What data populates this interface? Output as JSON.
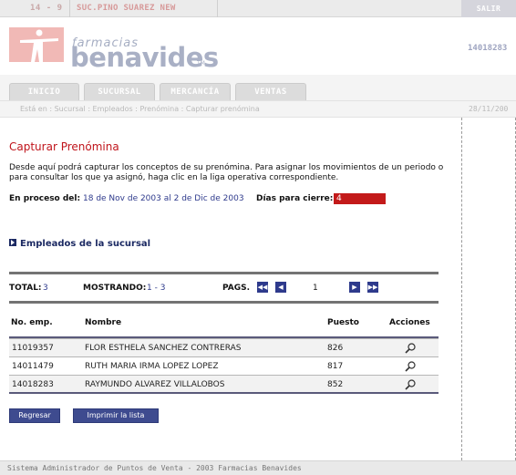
{
  "topbar": {
    "code": "14 - 9",
    "branch": "SUC.PINO SUAREZ NEW",
    "exit_label": "SALIR"
  },
  "header": {
    "logo_small": "farmacias",
    "logo_big": "benavides",
    "logo_tm": "TM",
    "employee_id": "14018283"
  },
  "nav": {
    "tabs": [
      {
        "label": "INICIO"
      },
      {
        "label": "SUCURSAL"
      },
      {
        "label": "MERCANCÍA"
      },
      {
        "label": "VENTAS"
      }
    ]
  },
  "breadcrumb": {
    "text": "Está en : Sucursal : Empleados : Prenómina : Capturar prenómina",
    "date": "28/11/200"
  },
  "main": {
    "title": "Capturar Prenómina",
    "description": "Desde aquí podrá capturar los conceptos de su prenómina. Para asignar los movimientos de un periodo o para consultar los que ya asignó, haga clic en la liga operativa correspondiente.",
    "process_label": "En proceso del:",
    "process_range": "18 de Nov de 2003 al 2 de Dic de 2003",
    "days_label": "Días para cierre:",
    "days_value": "4",
    "section_title": "Empleados de la sucursal"
  },
  "paging": {
    "total_label": "TOTAL:",
    "total_value": "3",
    "showing_label": "MOSTRANDO:",
    "showing_value": "1 - 3",
    "pages_label": "PAGS.",
    "page_number": "1",
    "first_icon": "first-page-icon",
    "prev_icon": "prev-page-icon",
    "next_icon": "next-page-icon",
    "last_icon": "last-page-icon"
  },
  "table": {
    "headers": [
      "No. emp.",
      "Nombre",
      "Puesto",
      "Acciones"
    ],
    "rows": [
      {
        "num": "11019357",
        "name": "FLOR ESTHELA SANCHEZ CONTRERAS",
        "puesto": "826",
        "icon": "magnifier-icon"
      },
      {
        "num": "14011479",
        "name": "RUTH MARIA IRMA LOPEZ LOPEZ",
        "puesto": "817",
        "icon": "magnifier-icon"
      },
      {
        "num": "14018283",
        "name": "RAYMUNDO ALVAREZ VILLALOBOS",
        "puesto": "852",
        "icon": "magnifier-icon"
      }
    ]
  },
  "buttons": {
    "back": "Regresar",
    "print": "Imprimir la lista"
  },
  "footer": {
    "text": "Sistema Administrador de Puntos de Venta - 2003 Farmacias Benavides"
  },
  "colors": {
    "title_red": "#c0141b",
    "link_blue": "#2e3a8c",
    "days_box": "#c31a1a",
    "logo_gray": "#a9b0c5"
  }
}
